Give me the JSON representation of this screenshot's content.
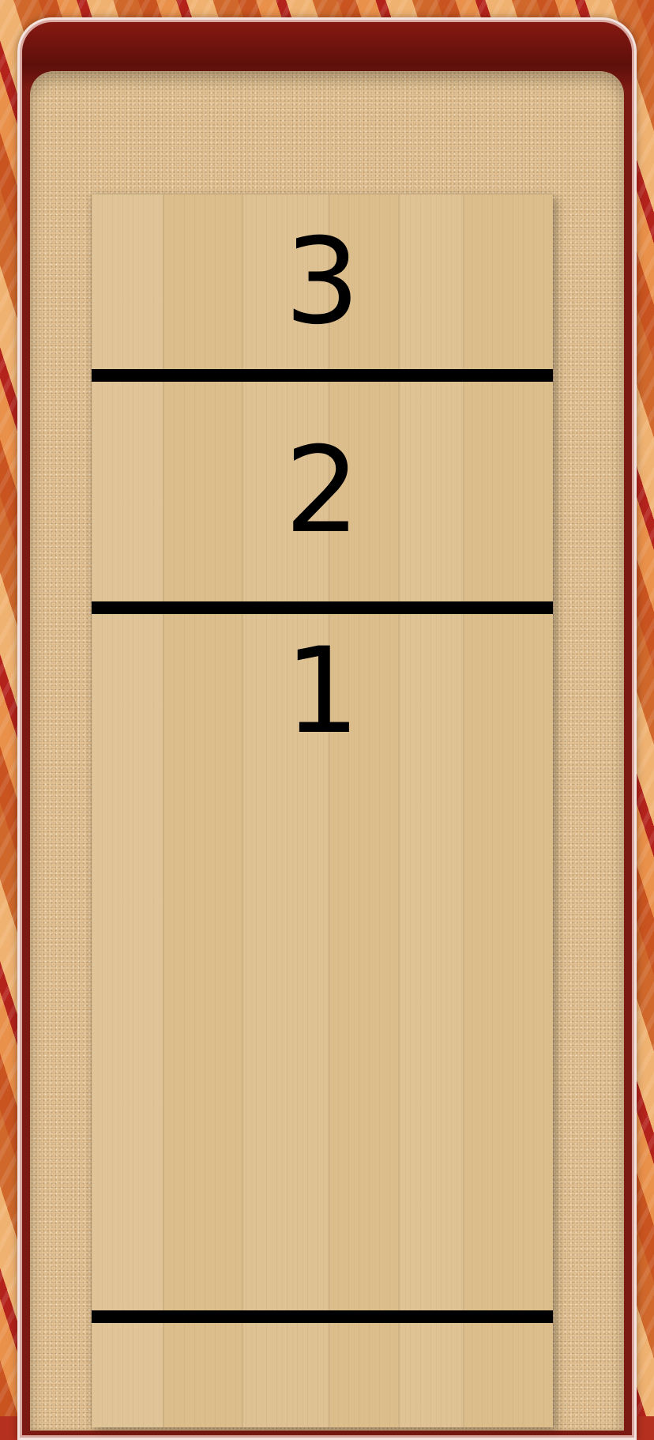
{
  "scoring_zones": [
    {
      "label": "3"
    },
    {
      "label": "2"
    },
    {
      "label": "1"
    }
  ],
  "colors": {
    "rail_wood": "#c9541f",
    "sand": "#e4c596",
    "board": "#dcbe8c",
    "lines": "#000000"
  }
}
